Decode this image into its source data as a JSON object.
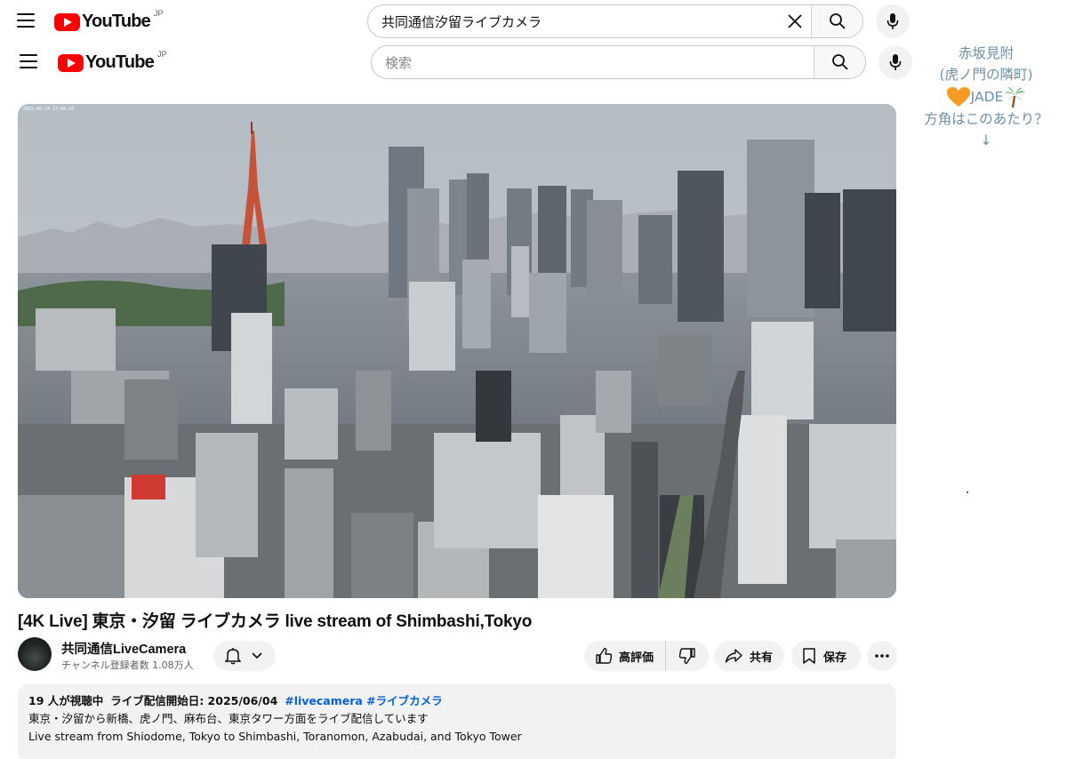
{
  "header_top": {
    "logo_text": "YouTube",
    "country_code": "JP",
    "search_value": "共同通信汐留ライブカメラ"
  },
  "header_second": {
    "logo_text": "YouTube",
    "country_code": "JP",
    "search_placeholder": "検索"
  },
  "annotation": {
    "line1": "赤坂見附",
    "line2": "(虎ノ門の隣町)",
    "jade": "JADE",
    "line4": "方角はこのあたり？",
    "arrow": "↓"
  },
  "video": {
    "timestamp": "2025-06-14 17:58:43",
    "title": "[4K Live] 東京・汐留 ライブカメラ live stream of Shimbashi,Tokyo"
  },
  "channel": {
    "name": "共同通信LiveCamera",
    "subscribers": "チャンネル登録者数 1.08万人"
  },
  "actions": {
    "like_label": "高評価",
    "share_label": "共有",
    "save_label": "保存"
  },
  "description": {
    "viewers": "19 人が視聴中",
    "started": "ライブ配信開始日: 2025/06/04",
    "tags": "#livecamera #ライブカメラ",
    "line_jp": "東京・汐留から新橋、虎ノ門、麻布台、東京タワー方面をライブ配信しています",
    "line_en": "Live stream from Shiodome, Tokyo to Shimbashi, Toranomon, Azabudai, and Tokyo Tower"
  },
  "icons": {
    "menu": "hamburger-menu-icon",
    "clear": "close-icon",
    "search": "search-icon",
    "mic": "microphone-icon",
    "bell": "bell-icon",
    "like": "thumbs-up-icon",
    "dislike": "thumbs-down-icon",
    "share": "share-arrow-icon",
    "save": "bookmark-icon",
    "more": "more-horizontal-icon",
    "heart": "orange-heart-icon",
    "palm": "palm-tree-icon"
  },
  "colors": {
    "brand_red": "#ff0000",
    "link_blue": "#065fd4",
    "annotation_blue": "#6e8fa8",
    "heart_orange": "#f59a23"
  }
}
